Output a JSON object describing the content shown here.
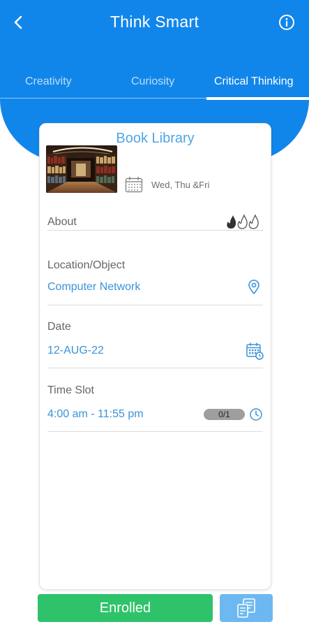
{
  "header": {
    "title": "Think Smart",
    "back_icon": "chevron-left-icon",
    "info_icon": "info-circle-icon",
    "background_color": "#1186ea"
  },
  "tabs": [
    {
      "label": "Creativity",
      "active": false
    },
    {
      "label": "Curiosity",
      "active": false
    },
    {
      "label": "Critical Thinking",
      "active": true
    }
  ],
  "card": {
    "title": "Book Library",
    "image": "library-bookshelves-photo",
    "schedule": "Wed, Thu &Fri",
    "about_label": "About",
    "difficulty_icons": "flame-icons",
    "fields": {
      "location": {
        "label": "Location/Object",
        "value": "Computer Network",
        "icon": "location-pin-icon"
      },
      "date": {
        "label": "Date",
        "value": "12-AUG-22",
        "icon": "calendar-icon"
      },
      "time_slot": {
        "label": "Time Slot",
        "value": "4:00 am - 11:55 pm",
        "slot_count": "0/1",
        "icon": "clock-icon"
      }
    }
  },
  "footer": {
    "enrolled_label": "Enrolled",
    "enrolled_color": "#2ec36a",
    "document_icon": "documents-icon",
    "document_button_color": "#6db8f0"
  }
}
